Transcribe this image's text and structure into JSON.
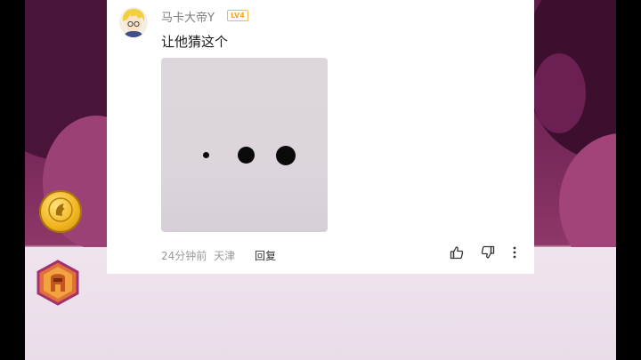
{
  "comment": {
    "username": "马卡大帝Y",
    "level": "LV4",
    "text": "让他猜这个",
    "time": "24分钟前",
    "location": "天津",
    "reply_label": "回复"
  },
  "icons": {
    "side_coin": "bird-coin-icon",
    "side_badge": "helmet-badge-icon",
    "like": "thumbs-up-icon",
    "dislike": "thumbs-down-icon",
    "more": "more-vertical-icon"
  },
  "colors": {
    "level_badge": "#f3a825",
    "video_background": "#7a2a5c",
    "lower_background": "#ece1ec"
  }
}
